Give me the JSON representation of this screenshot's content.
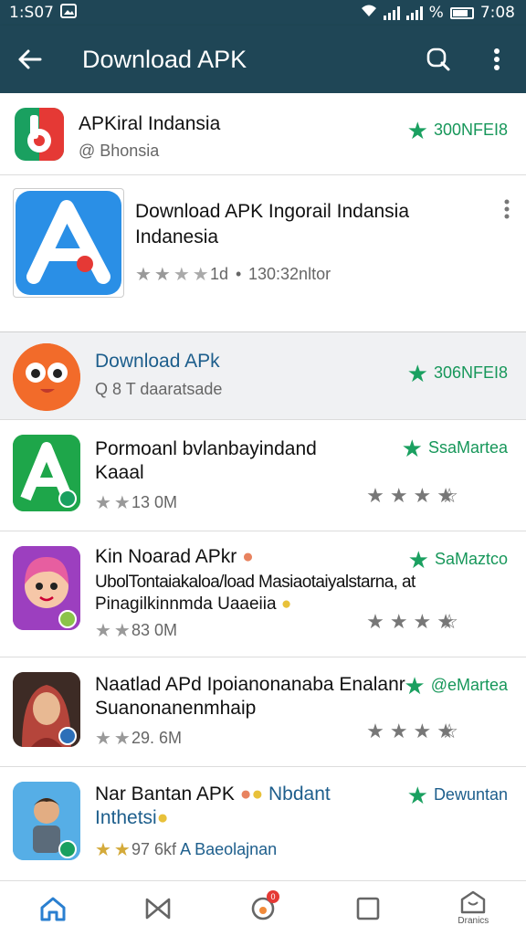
{
  "status": {
    "time_left": "1:S07",
    "battery_pct": "%",
    "time_right": "7:08"
  },
  "appbar": {
    "title": "Download APK"
  },
  "featured": {
    "name": "APKiral Indansia",
    "publisher": "@ Bhonsia",
    "badge": "300NFEI8"
  },
  "hero": {
    "title_line1": "Download APK Ingorail Indansia",
    "title_line2": "Indanesia",
    "age": "1d",
    "bullet": "•",
    "downloads": "130:32nltor",
    "rating_stars": 3
  },
  "highlight": {
    "name": "Download APk",
    "sub": "Q 8  T daaratsade",
    "badge": "306NFEI8"
  },
  "items": [
    {
      "title_line1": "Pormoanl bvlanbayindand",
      "title_line2": "Kaaal",
      "size": "13  0M",
      "tag": "SsaMartea",
      "rating": 4
    },
    {
      "title_line1": "Kin Noarad APkr",
      "title_line2": "UbolTontaiakaloa/load Masiaotaiyalstarna, at",
      "title_line3": "Pinagilkinnmda Uaaeiia",
      "size": "83  0M",
      "tag": "SaMaztco",
      "rating": 4
    },
    {
      "title_line1": "Naatlad APd Ipoianonanaba Enalanr",
      "title_line2": "Suanonanenmhaip",
      "size": "29. 6M",
      "tag": "@eMartea",
      "rating": 4
    },
    {
      "title_line1": "Nar Bantan APK",
      "title_line1_suffix": "Nbdant",
      "title_line2": "Inthetsi",
      "size": "97  6kf",
      "size_suffix": "A Baeolajnan",
      "tag": "Dewuntan",
      "rating": 2
    }
  ],
  "bottom_nav": {
    "last_label": "Dranics",
    "notif_count": "0"
  }
}
